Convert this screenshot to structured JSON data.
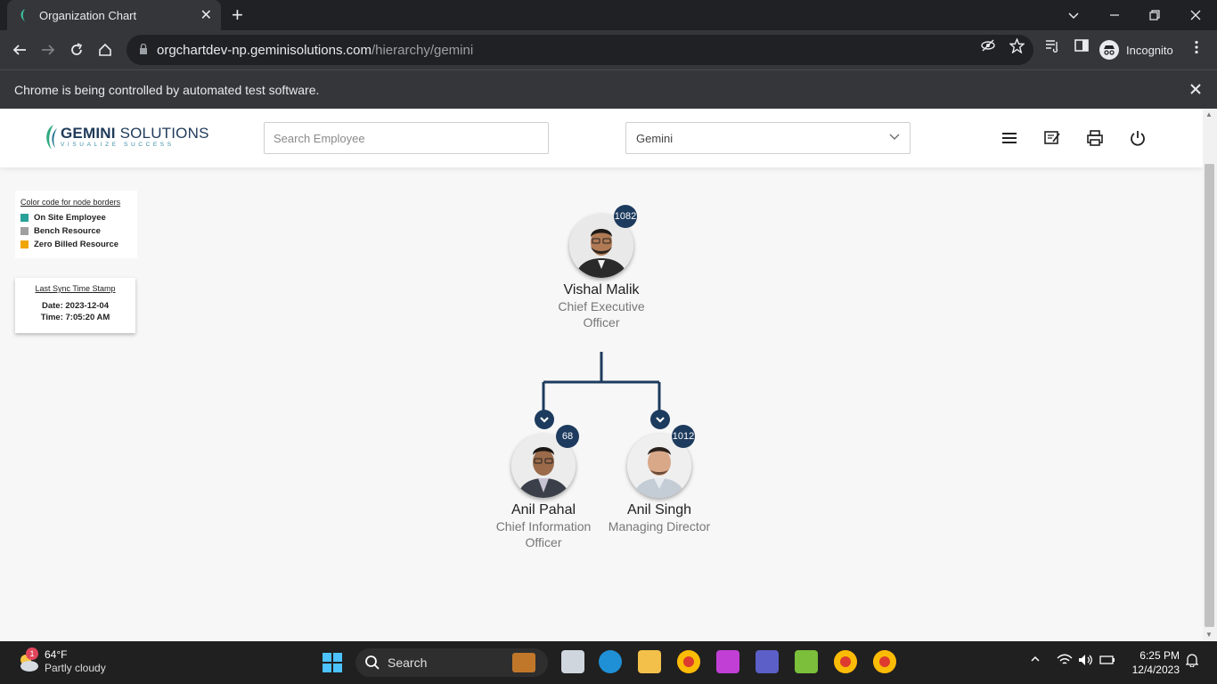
{
  "browser": {
    "tab_title": "Organization Chart",
    "new_tab": "+",
    "url_host": "orgchartdev-np.geminisolutions.com",
    "url_path": "/hierarchy/gemini",
    "profile_label": "Incognito",
    "infobar_text": "Chrome is being controlled by automated test software."
  },
  "header": {
    "logo_name_bold": "GEMINI",
    "logo_name_rest": " SOLUTIONS",
    "logo_tagline": "VISUALIZE SUCCESS",
    "search_placeholder": "Search Employee",
    "org_select_value": "Gemini"
  },
  "legend": {
    "title": "Color code for node borders",
    "items": [
      {
        "label": "On Site Employee",
        "color": "#2aa198"
      },
      {
        "label": "Bench Resource",
        "color": "#a0a0a0"
      },
      {
        "label": "Zero Billed Resource",
        "color": "#f0a500"
      }
    ]
  },
  "sync": {
    "title": "Last Sync Time Stamp",
    "date": "Date: 2023-12-04",
    "time": "Time: 7:05:20 AM"
  },
  "org": {
    "root": {
      "name": "Vishal Malik",
      "role_line1": "Chief Executive",
      "role_line2": "Officer",
      "count": "1082"
    },
    "children": [
      {
        "name": "Anil Pahal",
        "role_line1": "Chief Information",
        "role_line2": "Officer",
        "count": "68"
      },
      {
        "name": "Anil Singh",
        "role_line1": "Managing Director",
        "role_line2": "",
        "count": "1012"
      }
    ]
  },
  "taskbar": {
    "weather_temp": "64°F",
    "weather_desc": "Partly cloudy",
    "weather_badge": "1",
    "search_label": "Search",
    "time": "6:25 PM",
    "date": "12/4/2023"
  },
  "colors": {
    "accent": "#1d3b5e",
    "chrome_dark": "#202124"
  }
}
